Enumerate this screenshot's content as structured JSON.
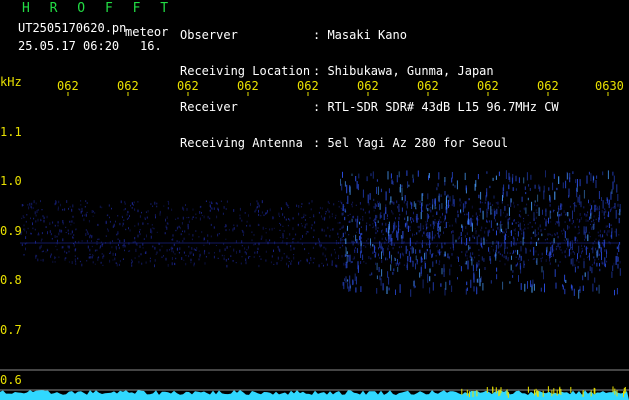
{
  "header": {
    "app_name": "H R O F F T",
    "filename": "UT2505170620.pn",
    "type": "meteor",
    "datetime": "25.05.17 06:20",
    "count": "16.",
    "meta_labels": [
      "Observer",
      "Receiving Location",
      "Receiver",
      "Receiving Antenna"
    ],
    "meta_values": [
      ": Masaki Kano",
      ": Shibukawa, Gunma, Japan",
      ": RTL-SDR SDR# 43dB L15 96.7MHz CW",
      ": 5el Yagi Az 280 for Seoul"
    ]
  },
  "axis": {
    "unit": "kHz",
    "time_ticks": [
      "062",
      "062",
      "062",
      "062",
      "062",
      "062",
      "062",
      "062",
      "062",
      "0630"
    ],
    "freq_ticks": [
      "1.1",
      "1.0",
      "0.9",
      "0.8",
      "0.7",
      "0.6"
    ]
  },
  "colors": {
    "background": "#000000",
    "label": "#e8e000",
    "accent": "#22dd44",
    "signal": "#1e2aa0",
    "echo": "#4aa0ff",
    "baseline": "#30d8ff"
  }
}
